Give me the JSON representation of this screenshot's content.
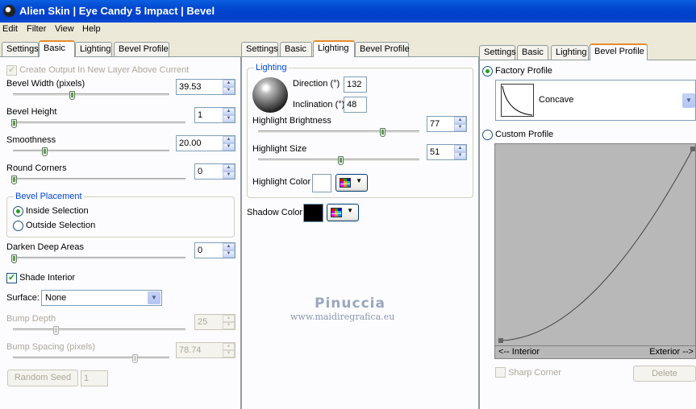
{
  "window": {
    "title": "Alien Skin  |  Eye Candy 5 Impact  |  Bevel"
  },
  "menu": [
    "Edit",
    "Filter",
    "View",
    "Help"
  ],
  "tabs_left": [
    "Settings",
    "Basic",
    "Lighting",
    "Bevel Profile"
  ],
  "tabs_mid": [
    "Settings",
    "Basic",
    "Lighting",
    "Bevel Profile"
  ],
  "tabs_right": [
    "Settings",
    "Basic",
    "Lighting",
    "Bevel Profile"
  ],
  "basic": {
    "create_output_label": "Create Output In New Layer Above Current",
    "create_output_checked": true,
    "bevel_width": {
      "label": "Bevel Width (pixels)",
      "value": "39.53",
      "level": 0.29
    },
    "bevel_height": {
      "label": "Bevel Height",
      "value": "1",
      "level": 0.01
    },
    "smoothness": {
      "label": "Smoothness",
      "value": "20.00",
      "level": 0.2
    },
    "round_corners": {
      "label": "Round Corners",
      "value": "0",
      "level": 0.0
    },
    "placement": {
      "title": "Bevel Placement",
      "inside": "Inside Selection",
      "outside": "Outside Selection",
      "selected": "inside"
    },
    "darken": {
      "label": "Darken Deep Areas",
      "value": "0",
      "level": 0.0
    },
    "shade_interior": {
      "label": "Shade Interior",
      "checked": true
    },
    "surface": {
      "label": "Surface:",
      "value": "None"
    },
    "bump_depth": {
      "label": "Bump Depth",
      "value": "25",
      "level": 0.25
    },
    "bump_spacing": {
      "label": "Bump Spacing (pixels)",
      "value": "78.74",
      "level": 0.75
    },
    "random_seed": {
      "label": "Random Seed",
      "value": "1"
    }
  },
  "lighting": {
    "group_title": "Lighting",
    "direction": {
      "label": "Direction (°)",
      "value": "132"
    },
    "inclination": {
      "label": "Inclination (°)",
      "value": "48"
    },
    "highlight_brightness": {
      "label": "Highlight Brightness",
      "value": "77",
      "level": 0.77
    },
    "highlight_size": {
      "label": "Highlight Size",
      "value": "51",
      "level": 0.51
    },
    "highlight_color": {
      "label": "Highlight Color",
      "color": "#ffffff"
    },
    "shadow_color": {
      "label": "Shadow Color",
      "color": "#000000"
    }
  },
  "profile": {
    "factory_label": "Factory Profile",
    "factory_value": "Concave",
    "custom_label": "Custom Profile",
    "selected": "factory",
    "interior_label": "<-- Interior",
    "exterior_label": "Exterior -->",
    "sharp_corner_label": "Sharp Corner",
    "delete_label": "Delete"
  },
  "watermark": {
    "line1": "Pinuccia",
    "line2": "www.maidiregrafica.eu"
  },
  "colors": {
    "accent": "#0046d5",
    "title_bar": "#0040c8",
    "tab_highlight": "#e68b2c"
  }
}
